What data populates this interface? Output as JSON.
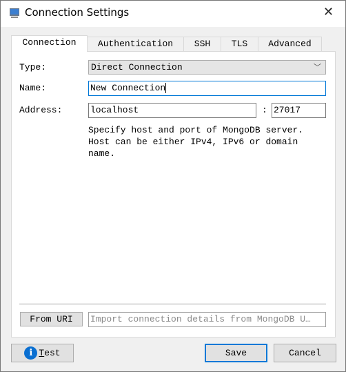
{
  "window": {
    "title": "Connection Settings",
    "close_icon": "close-icon",
    "app_icon": "monitor-icon"
  },
  "tabs": [
    {
      "label": "Connection",
      "selected": true
    },
    {
      "label": "Authentication"
    },
    {
      "label": "SSH"
    },
    {
      "label": "TLS"
    },
    {
      "label": "Advanced"
    }
  ],
  "form": {
    "type_label": "Type:",
    "type_value": "Direct Connection",
    "name_label": "Name:",
    "name_value": "New Connection",
    "address_label": "Address:",
    "host_value": "localhost",
    "colon": ":",
    "port_value": "27017",
    "help_line1": "Specify host and port of MongoDB server.",
    "help_line2": "Host can be either IPv4, IPv6 or domain",
    "help_line3": "name."
  },
  "uri": {
    "button": "From URI",
    "placeholder": "Import connection details from MongoDB U…"
  },
  "buttons": {
    "test_first": "T",
    "test_rest": "est",
    "save": "Save",
    "cancel": "Cancel"
  },
  "colors": {
    "accent": "#0078d7",
    "info_icon": "#0a6fd1"
  }
}
